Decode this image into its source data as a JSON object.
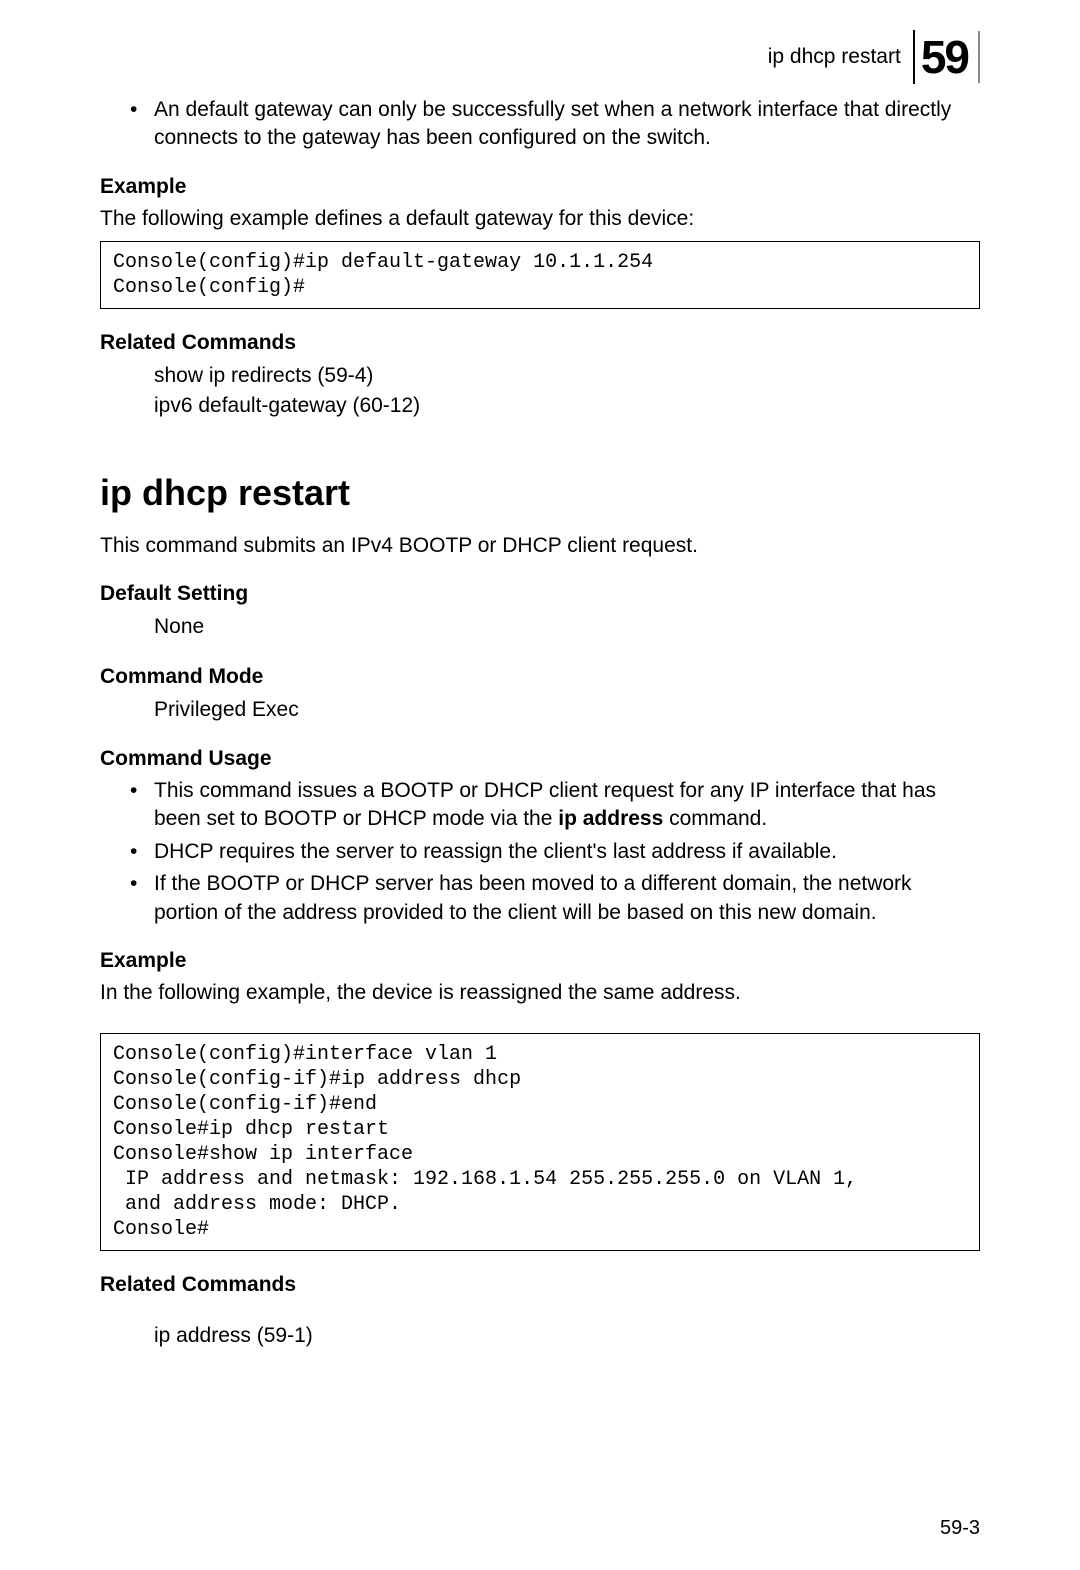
{
  "header": {
    "running_title": "ip dhcp restart",
    "chapter_number": "59"
  },
  "intro_bullets": [
    "An default gateway can only be successfully set when a network interface that directly connects to the gateway has been configured on the switch."
  ],
  "example1": {
    "heading": "Example",
    "lead": "The following example defines a default gateway for this device:",
    "code": "Console(config)#ip default-gateway 10.1.1.254\nConsole(config)#"
  },
  "related1": {
    "heading": "Related Commands",
    "items": [
      "show ip redirects (59-4)",
      "ipv6 default-gateway (60-12)"
    ]
  },
  "cmd": {
    "title": "ip dhcp restart",
    "description": "This command submits an IPv4 BOOTP or DHCP client request."
  },
  "default_setting": {
    "heading": "Default Setting",
    "value": "None"
  },
  "command_mode": {
    "heading": "Command Mode",
    "value": "Privileged Exec"
  },
  "command_usage": {
    "heading": "Command Usage",
    "bullets_prefix": "This command issues a BOOTP or DHCP client request for any IP interface that has been set to BOOTP or DHCP mode via the ",
    "bullets_boldword": "ip address",
    "bullets_suffix": " command.",
    "bullet2": "DHCP requires the server to reassign the client's last address if available.",
    "bullet3": "If the BOOTP or DHCP server has been moved to a different domain, the network portion of the address provided to the client will be based on this new domain."
  },
  "example2": {
    "heading": "Example",
    "lead": "In the following example, the device is reassigned the same address.",
    "code": "Console(config)#interface vlan 1\nConsole(config-if)#ip address dhcp\nConsole(config-if)#end\nConsole#ip dhcp restart\nConsole#show ip interface\n IP address and netmask: 192.168.1.54 255.255.255.0 on VLAN 1,\n and address mode: DHCP.\nConsole#"
  },
  "related2": {
    "heading": "Related Commands",
    "items": [
      "ip address (59-1)"
    ]
  },
  "page_number": "59-3"
}
